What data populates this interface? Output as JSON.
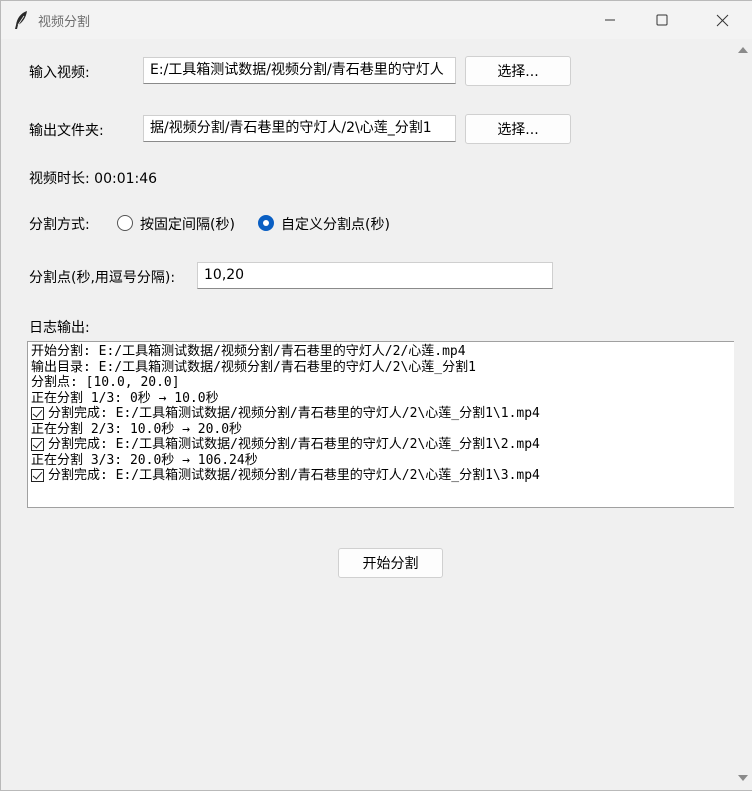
{
  "window": {
    "title": "视频分割"
  },
  "form": {
    "input_label": "输入视频:",
    "input_value": "E:/工具箱测试数据/视频分割/青石巷里的守灯人",
    "output_label": "输出文件夹:",
    "output_value": "据/视频分割/青石巷里的守灯人/2\\心莲_分割1",
    "select_label": "选择...",
    "duration_label": "视频时长: 00:01:46",
    "mode_label": "分割方式:",
    "mode_options": [
      {
        "label": "按固定间隔(秒)",
        "selected": false
      },
      {
        "label": "自定义分割点(秒)",
        "selected": true
      }
    ],
    "points_label": "分割点(秒,用逗号分隔):",
    "points_value": "10,20",
    "log_label": "日志输出:",
    "start_button": "开始分割"
  },
  "log": {
    "lines": [
      {
        "check": false,
        "text": "开始分割: E:/工具箱测试数据/视频分割/青石巷里的守灯人/2/心莲.mp4"
      },
      {
        "check": false,
        "text": "输出目录: E:/工具箱测试数据/视频分割/青石巷里的守灯人/2\\心莲_分割1"
      },
      {
        "check": false,
        "text": "分割点: [10.0, 20.0]"
      },
      {
        "check": false,
        "text": "正在分割 1/3: 0秒 → 10.0秒"
      },
      {
        "check": true,
        "text": "分割完成: E:/工具箱测试数据/视频分割/青石巷里的守灯人/2\\心莲_分割1\\1.mp4"
      },
      {
        "check": false,
        "text": "正在分割 2/3: 10.0秒 → 20.0秒"
      },
      {
        "check": true,
        "text": "分割完成: E:/工具箱测试数据/视频分割/青石巷里的守灯人/2\\心莲_分割1\\2.mp4"
      },
      {
        "check": false,
        "text": "正在分割 3/3: 20.0秒 → 106.24秒"
      },
      {
        "check": true,
        "text": "分割完成: E:/工具箱测试数据/视频分割/青石巷里的守灯人/2\\心莲_分割1\\3.mp4"
      }
    ]
  },
  "colors": {
    "accent": "#0a5fc3",
    "background": "#f0f0f0"
  }
}
